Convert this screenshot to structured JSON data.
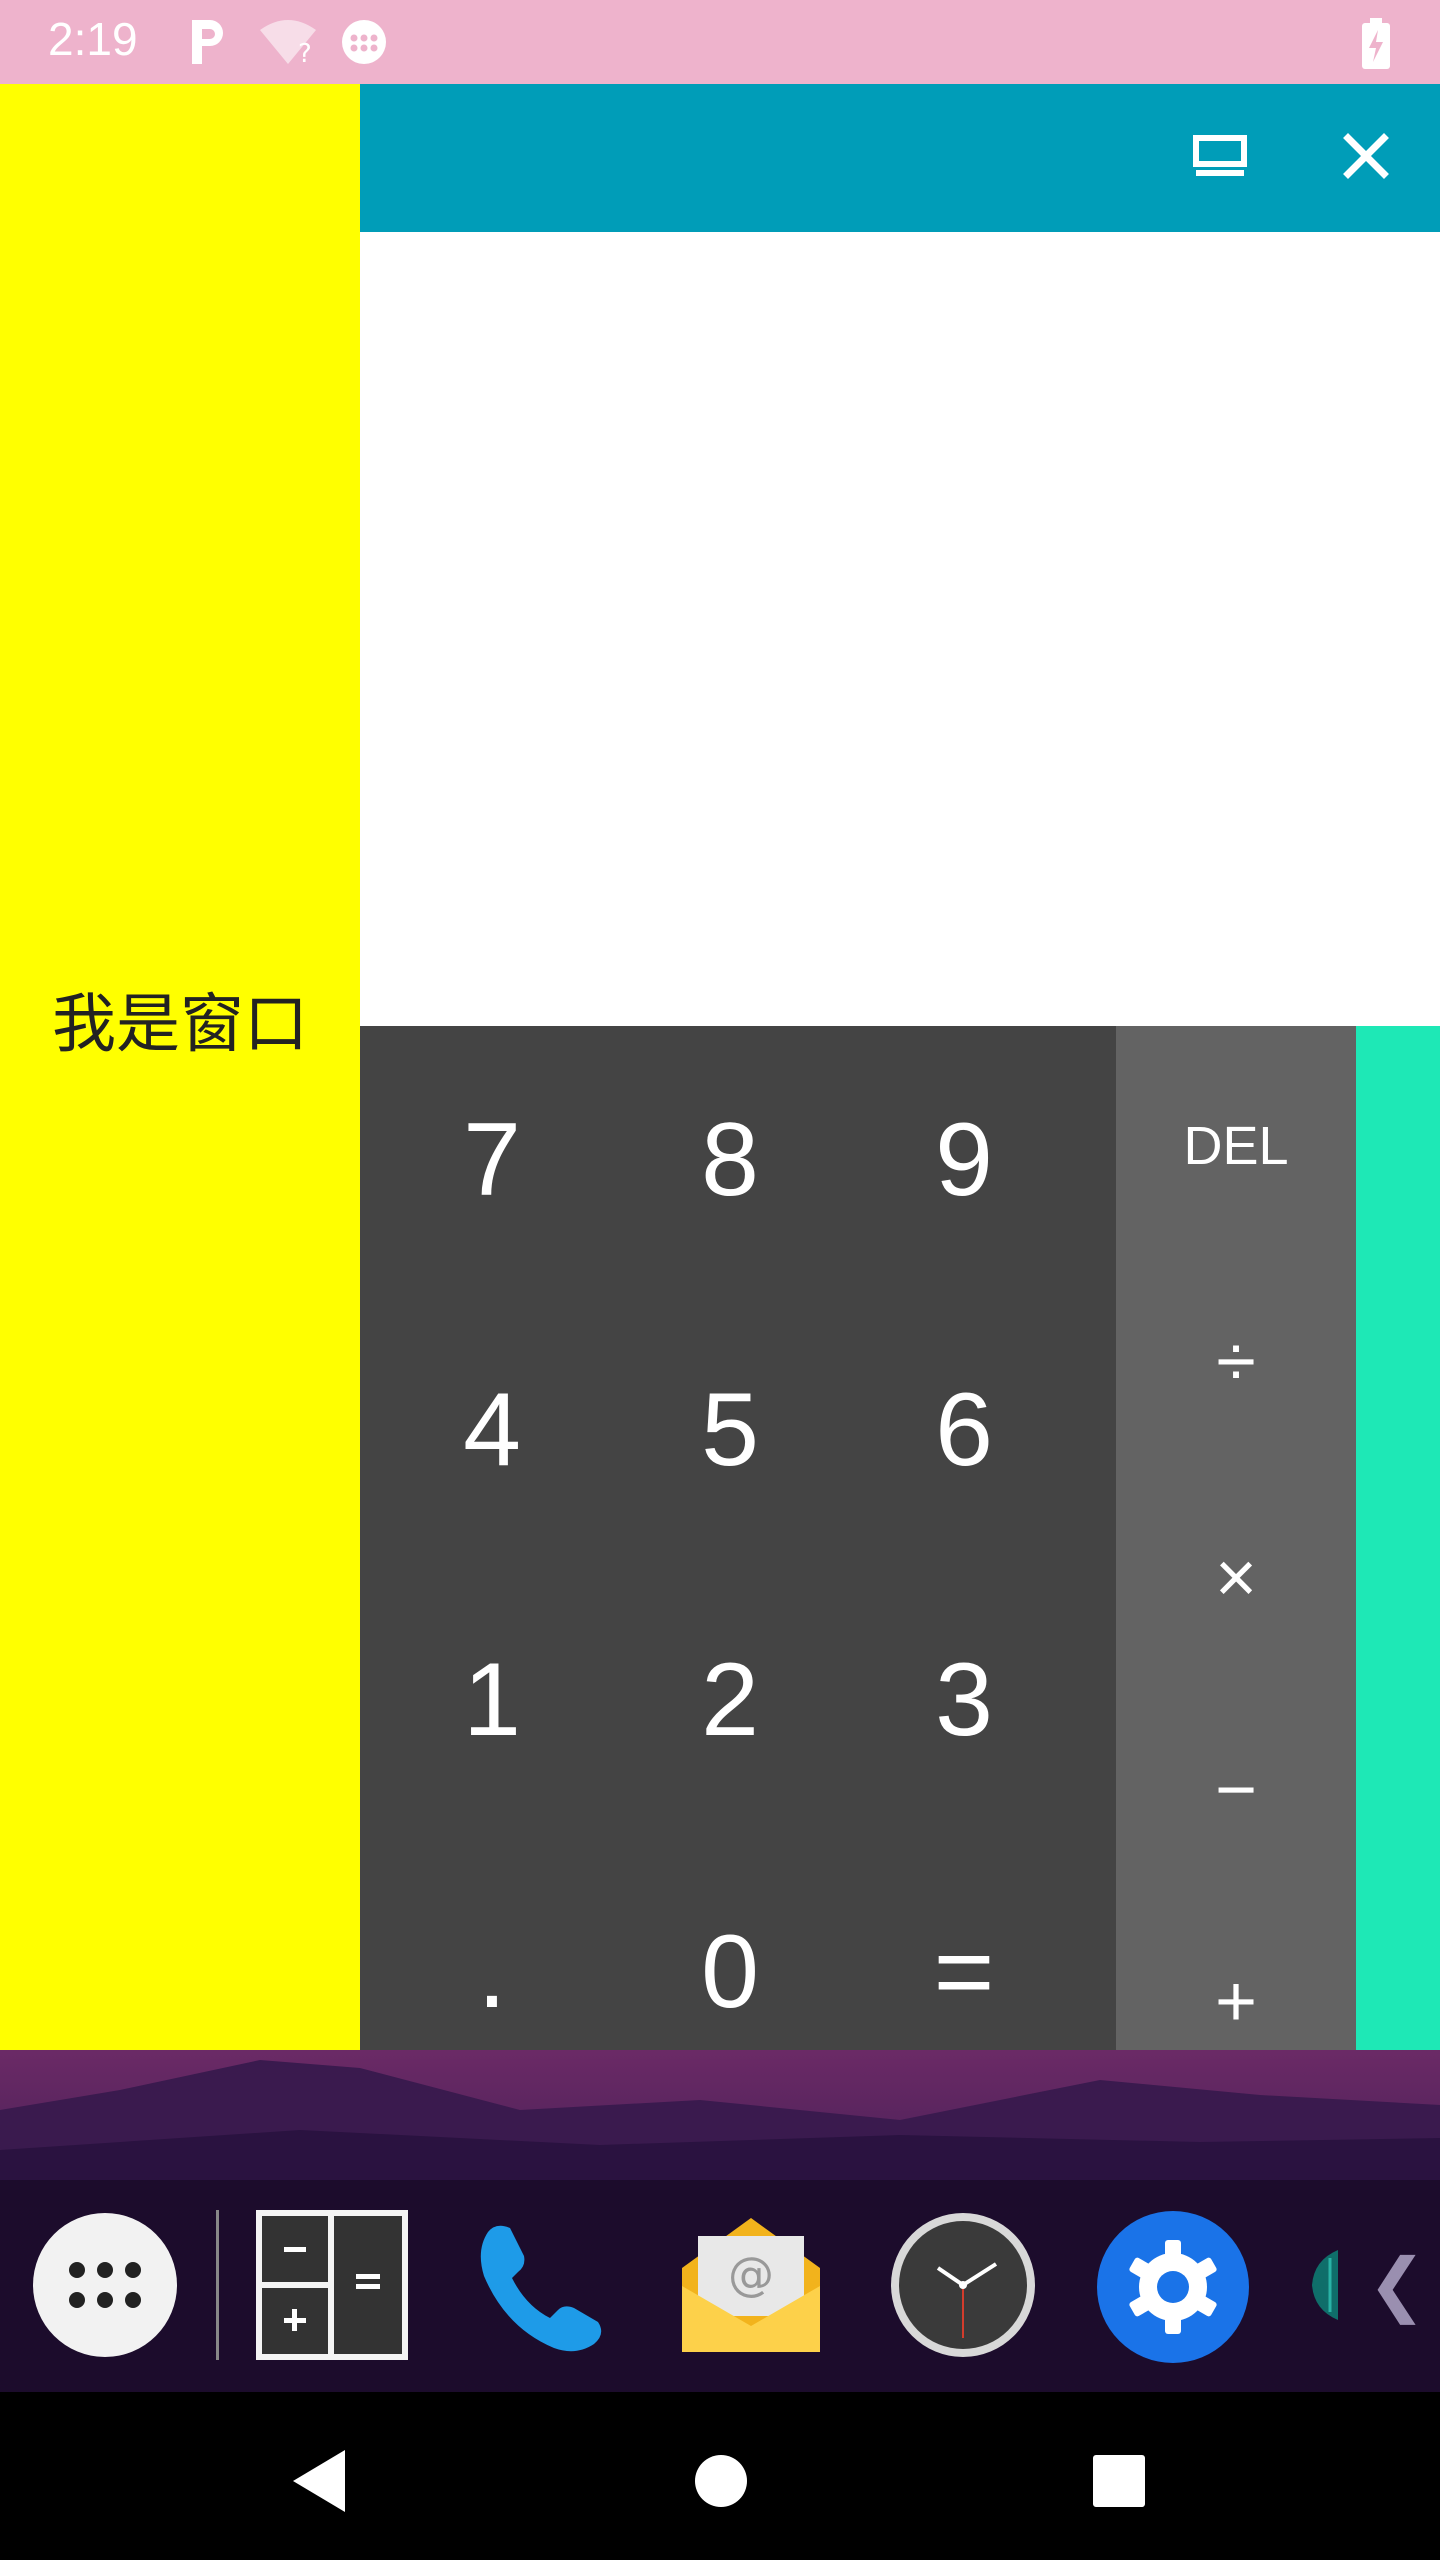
{
  "status_bar": {
    "time": "2:19",
    "icons": [
      "parking-icon",
      "wifi-question-icon",
      "dots-icon",
      "battery-charging-icon"
    ]
  },
  "side_panel": {
    "text": "我是窗口",
    "color": "#ffff00"
  },
  "window": {
    "title_bar_color": "#009db8",
    "buttons": [
      "minimize-window-icon",
      "close-icon"
    ]
  },
  "calculator": {
    "display_value": "",
    "keys": [
      [
        "7",
        "8",
        "9"
      ],
      [
        "4",
        "5",
        "6"
      ],
      [
        "1",
        "2",
        "3"
      ],
      [
        ".",
        "0",
        "="
      ]
    ],
    "operators": [
      "DEL",
      "÷",
      "×",
      "−",
      "+"
    ]
  },
  "dock": {
    "apps": [
      "app-drawer-icon",
      "calculator-icon",
      "phone-icon",
      "email-icon",
      "clock-icon",
      "settings-icon",
      "browser-icon"
    ],
    "more_label": "❮"
  },
  "nav_bar": {
    "buttons": [
      "back-icon",
      "home-icon",
      "recents-icon"
    ]
  }
}
